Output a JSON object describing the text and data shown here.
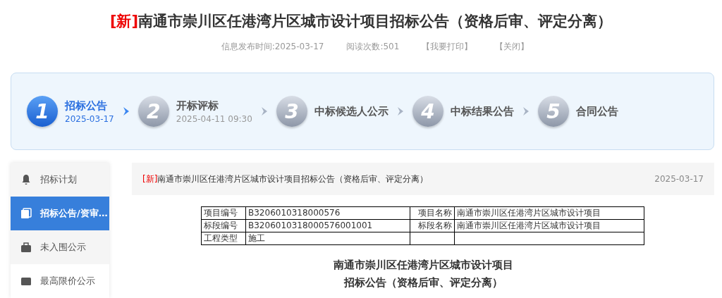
{
  "title": {
    "tag": "[新]",
    "text": "南通市崇川区任港湾片区城市设计项目招标公告（资格后审、评定分离）"
  },
  "meta": {
    "published": "信息发布时间:2025-03-17",
    "views": "阅读次数:501",
    "print": "【我要打印】",
    "close": "【关闭】"
  },
  "steps": [
    {
      "number": "1",
      "label": "招标公告",
      "date": "2025-03-17",
      "selected": true
    },
    {
      "number": "2",
      "label": "开标评标",
      "date": "2025-04-11 09:30",
      "selected": false
    },
    {
      "number": "3",
      "label": "中标候选人公示",
      "selected": false
    },
    {
      "number": "4",
      "label": "中标结果公告",
      "selected": false
    },
    {
      "number": "5",
      "label": "合同公告",
      "selected": false
    }
  ],
  "sidebar": {
    "items": [
      {
        "label": "招标计划",
        "selected": false
      },
      {
        "label": "招标公告/资审…",
        "selected": true
      },
      {
        "label": "未入围公示",
        "selected": false
      },
      {
        "label": "最高限价公示",
        "selected": false
      }
    ]
  },
  "article": {
    "tag": "[新]",
    "title": "南通市崇川区任港湾片区城市设计项目招标公告（资格后审、评定分离）",
    "date": "2025-03-17"
  },
  "table": {
    "rows": [
      {
        "cells": [
          "项目编号",
          "B3206010318000576",
          "项目名称",
          "南通市崇川区任港湾片区城市设计项目"
        ]
      },
      {
        "cells": [
          "标段编号",
          "B3206010318000576001001",
          "标段名称",
          "南通市崇川区任港湾片区城市设计项目"
        ]
      },
      {
        "cells": [
          "工程类型",
          "施工"
        ]
      }
    ]
  },
  "heading": [
    "南通市崇川区任港湾片区城市设计项目",
    "招标公告（资格后审、评定分离）"
  ]
}
